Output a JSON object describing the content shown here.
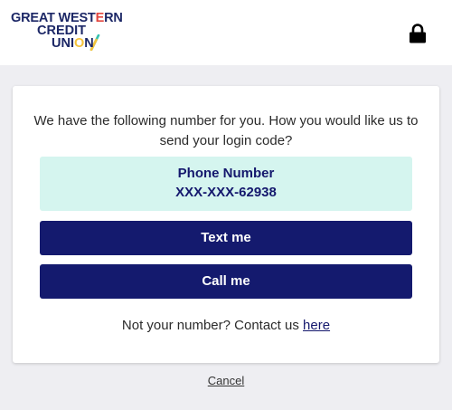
{
  "header": {
    "logo": {
      "line1": "GREAT WESTERN",
      "line2": "CREDIT",
      "line3": "UNION"
    },
    "lock_icon": "lock-icon"
  },
  "card": {
    "intro_text": "We have the following number for you. How you would like us to send your login code?",
    "phone": {
      "label": "Phone Number",
      "value": "XXX-XXX-62938"
    },
    "text_button": "Text me",
    "call_button": "Call me",
    "contact_prefix": "Not your number? Contact us ",
    "contact_link": "here"
  },
  "footer": {
    "cancel_link": "Cancel"
  },
  "colors": {
    "brand_navy": "#141a6e",
    "phone_box_bg": "#d5f5ef",
    "page_bg": "#eeeef2",
    "logo_accent_red": "#e2463f",
    "logo_accent_teal": "#37c3b1",
    "logo_accent_yellow": "#f5c33b"
  }
}
